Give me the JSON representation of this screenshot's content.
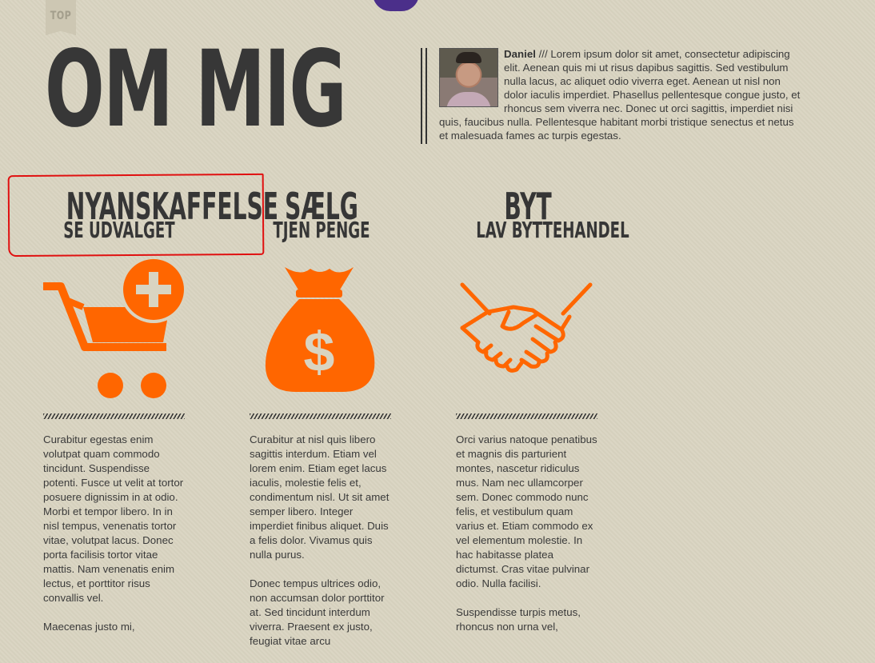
{
  "nav": {
    "top_label": "TOP"
  },
  "hero": {
    "title": "OM MIG"
  },
  "bio": {
    "name": "Daniel",
    "separator": " /// ",
    "text": "Lorem ipsum dolor sit amet, consectetur adipiscing elit. Aenean quis mi ut risus dapibus sagittis. Sed vestibulum nulla lacus, ac aliquet odio viverra eget. Aenean ut nisl non dolor iaculis imperdiet. Phasellus pellentesque congue justo, et rhoncus sem viverra nec. Donec ut orci sagittis, imperdiet nisi quis, faucibus nulla. Pellentesque habitant morbi tristique senectus et netus et malesuada fames ac turpis egestas."
  },
  "columns": [
    {
      "title": "NYANSKAFFELSE",
      "subtitle": "SE UDVALGET",
      "icon": "cart-plus-icon",
      "paragraphs": [
        "Curabitur egestas enim volutpat quam commodo tincidunt. Suspendisse potenti. Fusce ut velit at tortor posuere dignissim in at odio. Morbi et tempor libero. In in nisl tempus, venenatis tortor vitae, volutpat lacus. Donec porta facilisis tortor vitae mattis. Nam venenatis enim lectus, et porttitor risus convallis vel.",
        "Maecenas justo mi,"
      ]
    },
    {
      "title": "SÆLG",
      "subtitle": "TJEN PENGE",
      "icon": "money-bag-icon",
      "paragraphs": [
        "Curabitur at nisl quis libero sagittis interdum. Etiam vel lorem enim. Etiam eget lacus iaculis, molestie felis et, condimentum nisl. Ut sit amet semper libero. Integer imperdiet finibus aliquet. Duis a felis dolor. Vivamus quis nulla purus.",
        "Donec tempus ultrices odio, non accumsan dolor porttitor at. Sed tincidunt interdum viverra. Praesent ex justo, feugiat vitae arcu"
      ]
    },
    {
      "title": "BYT",
      "subtitle": "LAV BYTTEHANDEL",
      "icon": "handshake-icon",
      "paragraphs": [
        "Orci varius natoque penatibus et magnis dis parturient montes, nascetur ridiculus mus. Nam nec ullamcorper sem. Donec commodo nunc felis, et vestibulum quam varius et. Etiam commodo ex vel elementum molestie. In hac habitasse platea dictumst. Cras vitae pulvinar odio. Nulla facilisi.",
        "Suspendisse turpis metus, rhoncus non urna vel,"
      ]
    }
  ],
  "colors": {
    "accent": "#ff6600",
    "background": "#d9d4c1",
    "text": "#373737",
    "annotation": "#e01010"
  }
}
